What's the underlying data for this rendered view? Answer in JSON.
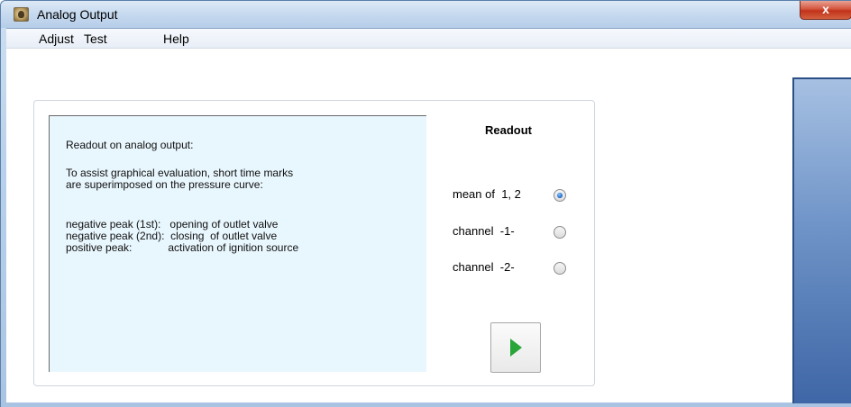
{
  "window": {
    "title": "Analog Output",
    "close_label": "x"
  },
  "menu": {
    "items": [
      "Adjust",
      "Test",
      "Help"
    ]
  },
  "info": {
    "lines": [
      "Readout on analog output:",
      "To assist graphical evaluation, short time marks",
      "are superimposed on the pressure curve:",
      "negative peak (1st):   opening of outlet valve",
      "negative peak (2nd):  closing  of outlet valve",
      "positive peak:            activation of ignition source"
    ]
  },
  "readout": {
    "title": "Readout",
    "options": [
      {
        "label": "mean of  1, 2",
        "selected": true
      },
      {
        "label": "channel  -1-",
        "selected": false
      },
      {
        "label": "channel  -2-",
        "selected": false
      }
    ]
  },
  "colors": {
    "play_icon": "#2aa53a",
    "info_background": "#e8f6fd"
  },
  "icons": {
    "app": "analog-output-app-icon",
    "play": "play-icon"
  }
}
